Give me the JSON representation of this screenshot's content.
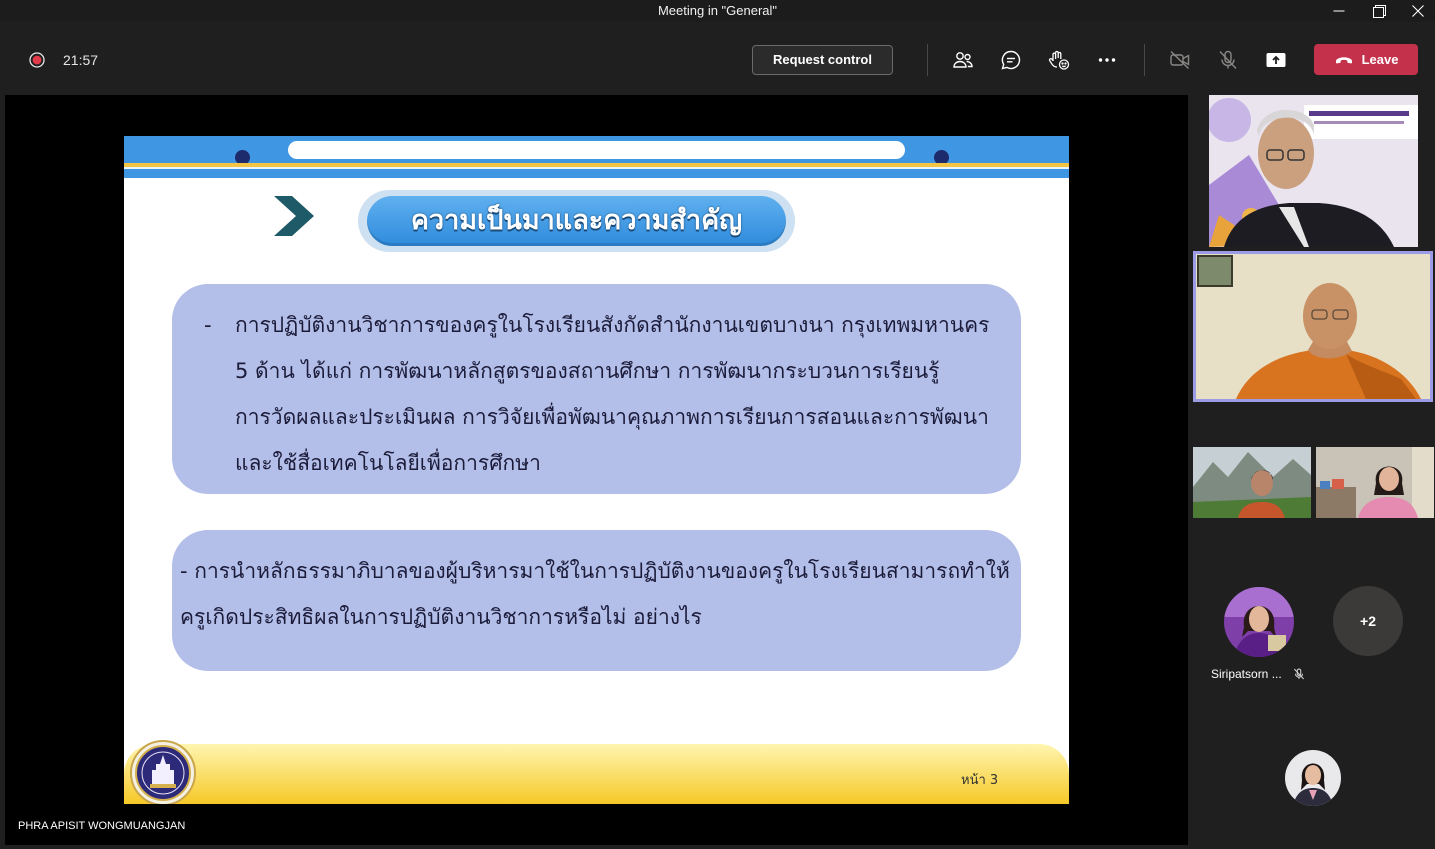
{
  "window": {
    "title": "Meeting in \"General\"",
    "minimize_icon": "minimize-icon",
    "restore_icon": "restore-icon",
    "close_icon": "close-icon"
  },
  "toolbar": {
    "recording_icon": "recording-icon",
    "timer": "21:57",
    "request_control_label": "Request control",
    "participants_icon": "participants-icon",
    "chat_icon": "chat-icon",
    "reactions_icon": "reactions-icon",
    "more_icon": "more-options-icon",
    "camera_icon": "camera-off-icon",
    "mic_icon": "mic-off-icon",
    "share_icon": "share-tray-icon",
    "leave_icon": "phone-hangup-icon",
    "leave_label": "Leave"
  },
  "shared_screen": {
    "presenter_name": "PHRA APISIT WONGMUANGJAN",
    "slide": {
      "section_icon": "chevron-right-icon",
      "title": "ความเป็นมาและความสำคัญ",
      "box1": {
        "bullet": "-",
        "lines": [
          "การปฏิบัติงานวิชาการของครูในโรงเรียนสังกัดสำนักงานเขตบางนา กรุงเทพมหานคร",
          "5 ด้าน ได้แก่ การพัฒนาหลักสูตรของสถานศึกษา การพัฒนากระบวนการเรียนรู้",
          "การวัดผลและประเมินผล การวิจัยเพื่อพัฒนาคุณภาพการเรียนการสอนและการพัฒนา",
          "และใช้สื่อเทคโนโลยีเพื่อการศึกษา"
        ]
      },
      "box2": {
        "lines": [
          "- การนำหลักธรรมาภิบาลของผู้บริหารมาใช้ในการปฏิบัติงานของครูในโรงเรียนสามารถทำให้",
          "ครูเกิดประสิทธิผลในการปฏิบัติงานวิชาการหรือไม่ อย่างไร"
        ]
      },
      "logo_icon": "university-seal-logo",
      "page_label": "หน้า 3"
    }
  },
  "participants": {
    "avatar_tile": {
      "name": "Siripatsorn ...",
      "mic_icon": "mic-off-icon"
    },
    "overflow_count": "+2"
  },
  "colors": {
    "leave_button": "#c4314b",
    "active_speaker_border": "#9b9be6",
    "slide_header_blue": "#3f97e3",
    "slide_box_lavender": "#b3bfe9",
    "slide_title_blue": "#2f8bdc",
    "slide_footer_yellow": "#f6c928",
    "recording_red": "#e03a4b"
  }
}
